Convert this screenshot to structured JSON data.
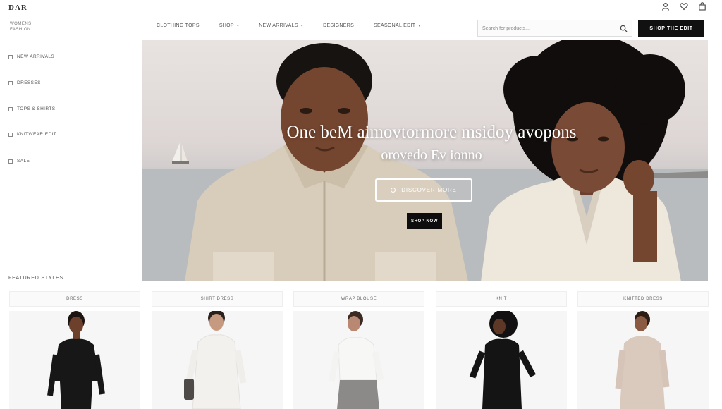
{
  "header": {
    "logo": "DAR",
    "tagline": "WOMENS FASHION",
    "nav": [
      {
        "label": "CLOTHING  TOPS",
        "has_caret": false
      },
      {
        "label": "SHOP",
        "has_caret": true
      },
      {
        "label": "NEW ARRIVALS",
        "has_caret": true
      },
      {
        "label": "DESIGNERS",
        "has_caret": false
      },
      {
        "label": "SEASONAL EDIT",
        "has_caret": true
      }
    ],
    "search_placeholder": "Search for products...",
    "cta_label": "SHOP THE EDIT",
    "icons": [
      "user-icon",
      "heart-icon",
      "bag-icon"
    ]
  },
  "sidebar": {
    "items": [
      {
        "label": "NEW ARRIVALS"
      },
      {
        "label": "DRESSES"
      },
      {
        "label": "TOPS & SHIRTS"
      },
      {
        "label": "KNITWEAR EDIT"
      },
      {
        "label": "SALE"
      }
    ]
  },
  "hero": {
    "headline": "One beM aimovtormore msidoy avopons",
    "subline": "orovedo Ev ionno",
    "outline_button": "DISCOVER MORE",
    "dark_button": "SHOP NOW"
  },
  "products": {
    "section_title": "FEATURED STYLES",
    "items": [
      {
        "label": "DRESS",
        "garment": "black long-sleeve dress",
        "color": "#1a1a1a"
      },
      {
        "label": "SHIRT DRESS",
        "garment": "white shirt dress",
        "color": "#f0f0ee"
      },
      {
        "label": "WRAP BLOUSE",
        "garment": "white blouse, grey skirt",
        "color": "#f4f4f4"
      },
      {
        "label": "KNIT",
        "garment": "black knit top",
        "color": "#151515"
      },
      {
        "label": "KNITTED DRESS",
        "garment": "beige knit dress",
        "color": "#d9c8bd"
      }
    ]
  },
  "colors": {
    "accent_dark": "#111111",
    "background": "#ffffff",
    "hero_sea": "#b8bcbf",
    "hero_sky": "#e6e0de"
  }
}
